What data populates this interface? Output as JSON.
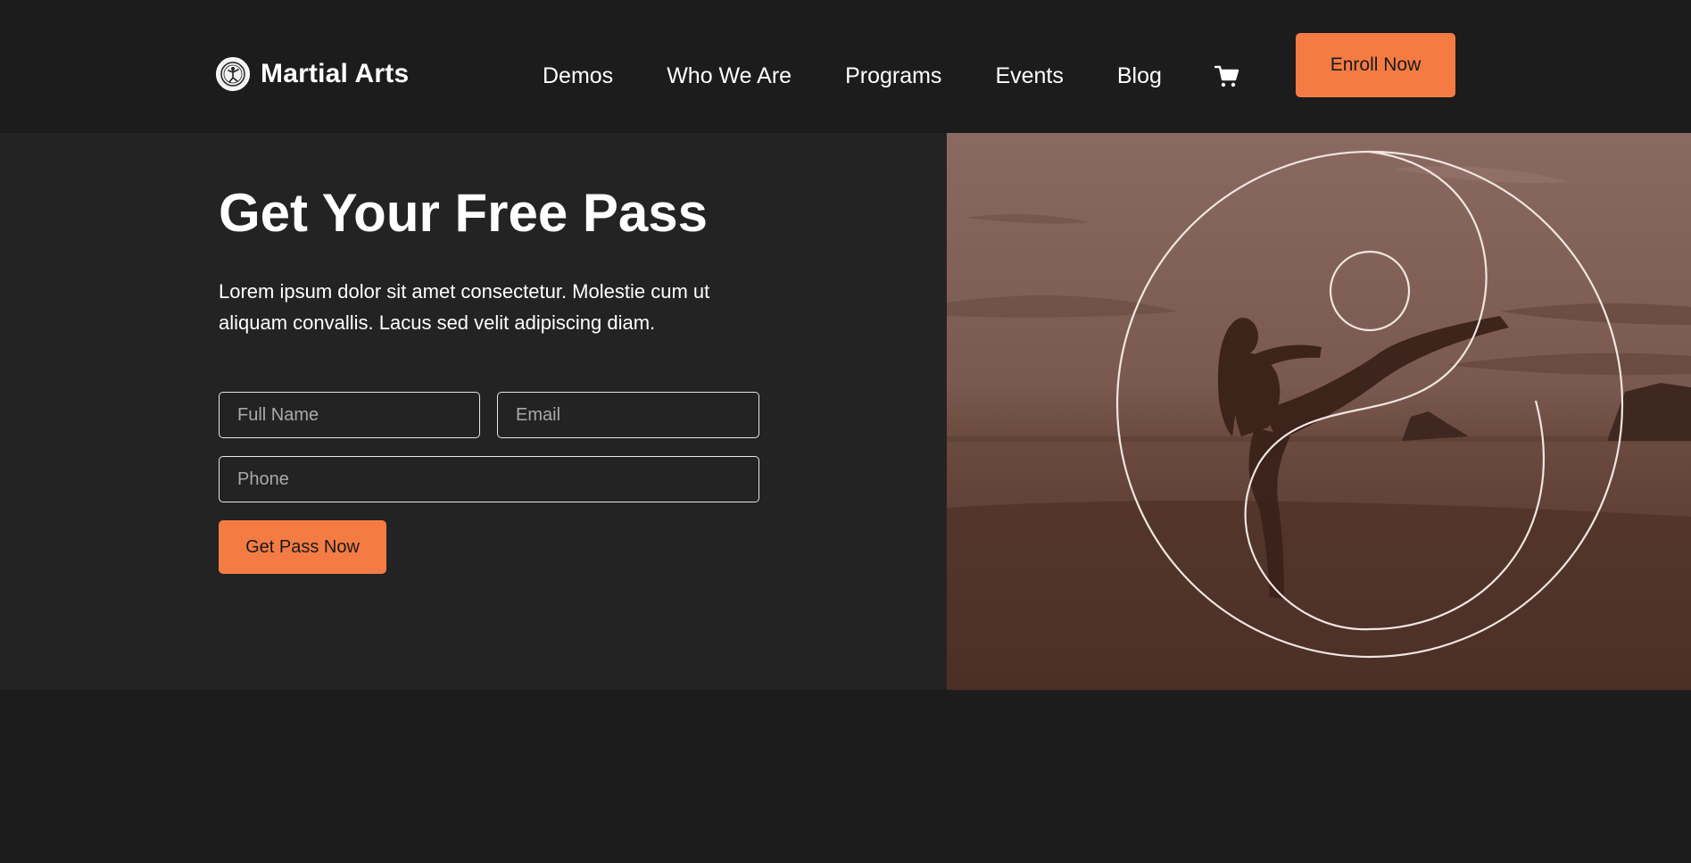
{
  "brand": {
    "name": "Martial Arts"
  },
  "nav": {
    "items": [
      {
        "label": "Demos"
      },
      {
        "label": "Who We Are"
      },
      {
        "label": "Programs"
      },
      {
        "label": "Events"
      },
      {
        "label": "Blog"
      }
    ],
    "cart_icon": "cart-icon",
    "enroll_label": "Enroll Now"
  },
  "hero": {
    "title": "Get Your Free Pass",
    "description": "Lorem ipsum dolor sit amet consectetur. Molestie cum ut aliquam convallis. Lacus sed velit adipiscing diam.",
    "form": {
      "full_name_placeholder": "Full Name",
      "email_placeholder": "Email",
      "phone_placeholder": "Phone",
      "full_name_value": "",
      "email_value": "",
      "phone_value": "",
      "submit_label": "Get Pass Now"
    },
    "image": {
      "icon": "yin-yang-icon",
      "tint": "#6b4436"
    }
  },
  "colors": {
    "accent": "#f47c44",
    "background": "#1c1c1c",
    "panel": "#232323"
  }
}
